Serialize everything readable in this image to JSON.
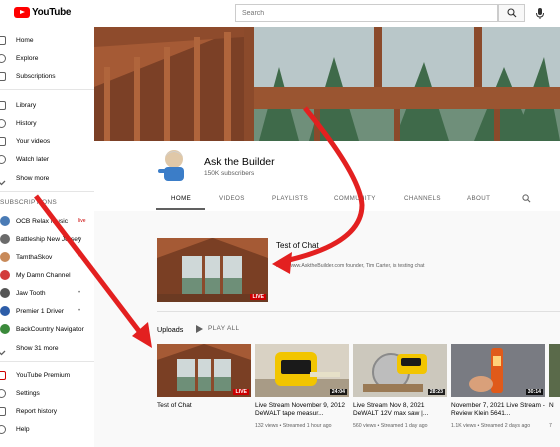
{
  "header": {
    "logo_text": "YouTube",
    "search_placeholder": "Search"
  },
  "sidebar": {
    "main": [
      "Home",
      "Explore",
      "Subscriptions"
    ],
    "library": [
      "Library",
      "History",
      "Your videos",
      "Watch later",
      "Show more"
    ],
    "subs_heading": "SUBSCRIPTIONS",
    "subscriptions": [
      {
        "name": "OCB Relax Music",
        "badge": "live",
        "color": "#4a7bb5"
      },
      {
        "name": "Battleship New Jersey",
        "badge": "•",
        "color": "#6b6b6b"
      },
      {
        "name": "TamthaSkov",
        "badge": "•",
        "color": "#c88a5a"
      },
      {
        "name": "My Damn Channel",
        "badge": "",
        "color": "#d23b3b"
      },
      {
        "name": "Jaw Tooth",
        "badge": "•",
        "color": "#555555"
      },
      {
        "name": "Premier 1 Driver",
        "badge": "•",
        "color": "#2d5da8"
      },
      {
        "name": "BackCountry Navigator",
        "badge": "",
        "color": "#3b8a3b"
      },
      {
        "name": "Show 31 more",
        "badge": "",
        "color": ""
      }
    ],
    "more": [
      "YouTube Premium",
      "Settings",
      "Report history",
      "Help"
    ]
  },
  "channel": {
    "name": "Ask the Builder",
    "subscribers": "150K subscribers",
    "tabs": [
      "HOME",
      "VIDEOS",
      "PLAYLISTS",
      "COMMUNITY",
      "CHANNELS",
      "ABOUT"
    ]
  },
  "featured": {
    "title": "Test of Chat",
    "description": "http://www.AsktheBuilder.com founder, Tim Carter, is testing chat"
  },
  "uploads": {
    "heading": "Uploads",
    "play_all": "PLAY ALL",
    "videos": [
      {
        "title": "Test of Chat",
        "meta": "",
        "badge": "LIVE",
        "live": true
      },
      {
        "title": "Live Stream November 9, 2012 DeWALT tape measur...",
        "meta": "132 views • Streamed 1 hour ago",
        "badge": "24:04",
        "live": false
      },
      {
        "title": "Live Stream Nov 8, 2021 DeWALT 12V max saw |...",
        "meta": "560 views • Streamed 1 day ago",
        "badge": "28:23",
        "live": false
      },
      {
        "title": "November 7, 2021 Live Stream - Review Klein 5641...",
        "meta": "1.1K views • Streamed 2 days ago",
        "badge": "30:14",
        "live": false
      },
      {
        "title": "N",
        "meta": "7",
        "badge": "",
        "live": false
      }
    ]
  }
}
